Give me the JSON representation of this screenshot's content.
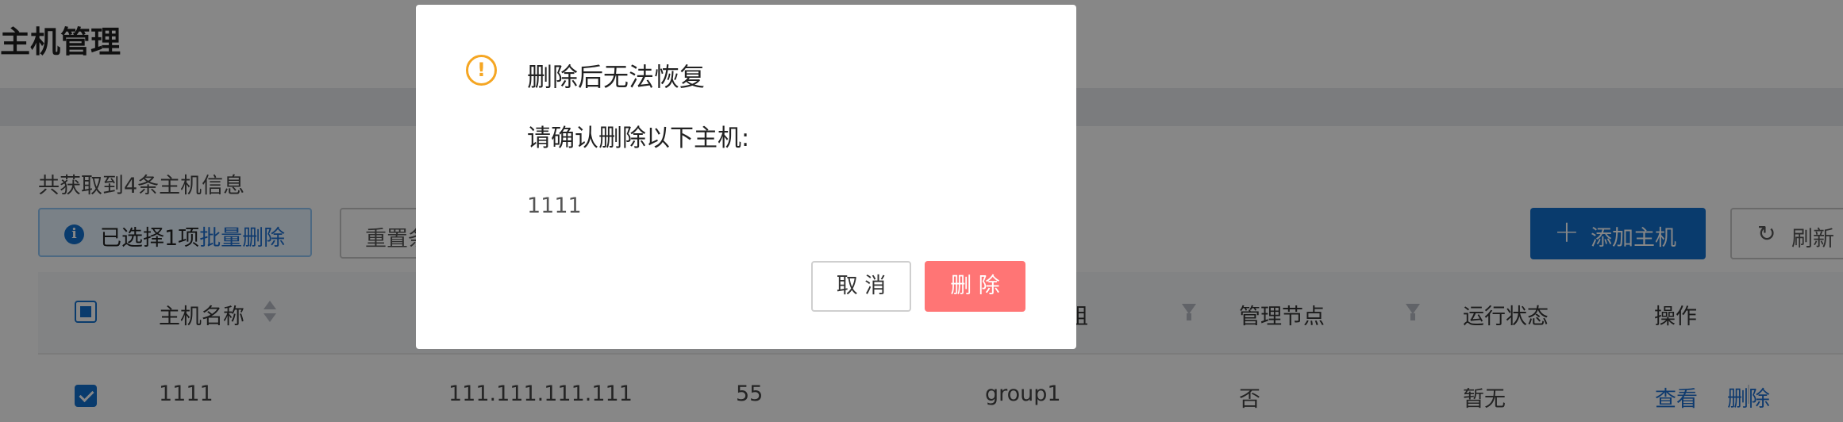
{
  "page": {
    "title": "主机管理",
    "summary": "共获取到4条主机信息",
    "selection": {
      "text": "已选择1项",
      "batch_delete": "批量删除"
    },
    "reset_label": "重置条",
    "add_host_label": "添加主机",
    "refresh_label": "刷新"
  },
  "table": {
    "headers": {
      "name": "主机名称",
      "group": "组",
      "node": "管理节点",
      "status": "运行状态",
      "actions": "操作"
    },
    "rows": [
      {
        "name": "1111",
        "ip": "111.111.111.111",
        "port": "55",
        "group": "group1",
        "node": "否",
        "status": "暂无",
        "view": "查看",
        "delete": "删除"
      }
    ]
  },
  "dialog": {
    "title": "删除后无法恢复",
    "subtitle": "请确认删除以下主机:",
    "host": "1111",
    "cancel": "取 消",
    "confirm": "删 除",
    "icon": "warning-circle-icon"
  },
  "colors": {
    "primary": "#1170cf",
    "danger": "#ff7575",
    "warning": "#f5a623",
    "link": "#1d6fd0"
  }
}
